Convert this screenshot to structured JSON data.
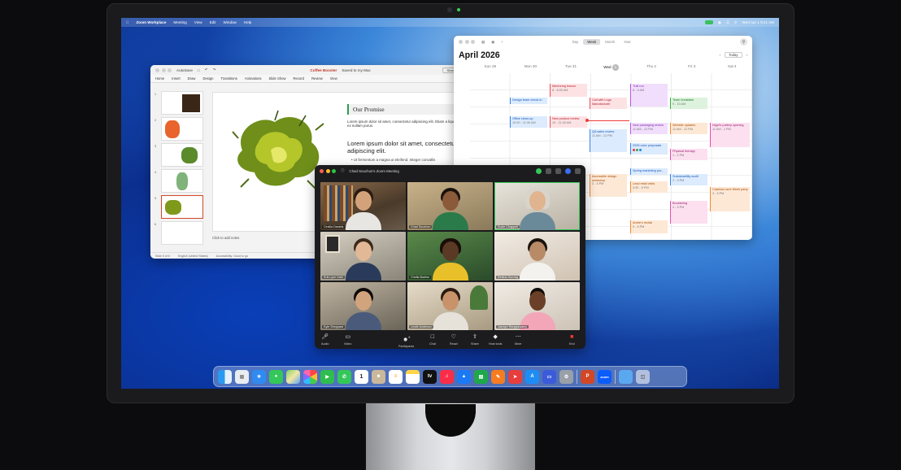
{
  "menubar": {
    "app": "Zoom Workplace",
    "items": [
      "Meeting",
      "View",
      "Edit",
      "Window",
      "Help"
    ],
    "clock": "Wed Apr 1 9:41 AM"
  },
  "powerpoint": {
    "autosave": "AutoSave",
    "doc_title": "Coffee Booster",
    "saved": "Saved to my Mac",
    "share": "Share",
    "ribbon_tabs": [
      "Home",
      "Insert",
      "Draw",
      "Design",
      "Transitions",
      "Animations",
      "Slide Show",
      "Record",
      "Review",
      "View"
    ],
    "thumb_numbers": [
      "1",
      "2",
      "3",
      "4",
      "5",
      "6"
    ],
    "slide": {
      "heading": "Our Promise",
      "body_small": "Lorem ipsum dolor sit amet, consectetur adipiscing elit. Etiam a liquet ex nullam purus.",
      "body_big": "Lorem ipsum dolor sit amet, consectetur adipiscing elit.",
      "bullet": "• Ut fermentum a magna ut eleifend. Integer convallis"
    },
    "notes": "Click to add notes",
    "status": [
      "Slide 5 of 6",
      "English (United States)",
      "Accessibility: Good to go"
    ]
  },
  "calendar": {
    "views": [
      "Day",
      "Week",
      "Month",
      "Year"
    ],
    "active_view": "Week",
    "month": "April 2026",
    "today": "Today",
    "days": [
      {
        "label": "Sun 29"
      },
      {
        "label": "Mon 30"
      },
      {
        "label": "Tue 31"
      },
      {
        "label": "Wed",
        "badge": "1"
      },
      {
        "label": "Thu 2"
      },
      {
        "label": "Fri 3"
      },
      {
        "label": "Sat 4"
      }
    ],
    "events": [
      {
        "title": "Mentoring lesson",
        "time": "8 - 8:30 AM",
        "color": "red"
      },
      {
        "title": "Design team check-in",
        "time": "",
        "color": "blue"
      },
      {
        "title": "Call with Logo Manufacturer",
        "time": "",
        "color": "red"
      },
      {
        "title": "Trail run",
        "time": "8 - 9 AM",
        "color": "purple"
      },
      {
        "title": "Team breakfast",
        "time": "9 - 10 AM",
        "color": "green"
      },
      {
        "title": "Office clean-up",
        "time": "10:30 - 11:30 AM",
        "color": "blue"
      },
      {
        "title": "New product review",
        "time": "10 - 11:30 AM",
        "color": "red"
      },
      {
        "title": "New packaging review",
        "time": "11 AM - 12 PM",
        "color": "purple"
      },
      {
        "title": "Website updates",
        "time": "11 AM - 12 PM",
        "color": "orange"
      },
      {
        "title": "Nigel's pottery opening",
        "time": "11 AM - 1 PM",
        "color": "pink"
      },
      {
        "title": "QA sales review",
        "time": "11 AM - 12 PM",
        "color": "blue"
      },
      {
        "title": "2025 color proposals",
        "time": "",
        "color": "blue"
      },
      {
        "title": "Physical therapy",
        "time": "1 - 2 PM",
        "color": "pink"
      },
      {
        "title": "Spring marketing pro...",
        "time": "",
        "color": "blue"
      },
      {
        "title": "Sustainability audit",
        "time": "2 - 3 PM",
        "color": "blue"
      },
      {
        "title": "Accessible design workshop",
        "time": "2 - 4 PM",
        "color": "orange"
      },
      {
        "title": "Lead retail visits",
        "time": "3:30 - 5 PM",
        "color": "orange"
      },
      {
        "title": "Catalina Lane Week party",
        "time": "3 - 5 PM",
        "color": "orange"
      },
      {
        "title": "Bouldering",
        "time": "4 - 5 PM",
        "color": "pink"
      },
      {
        "title": "Andre's recital",
        "time": "5 - 6 PM",
        "color": "orange"
      }
    ]
  },
  "zoom": {
    "title": "Chad Souchon's Zoom Meeting",
    "participants": [
      {
        "name": "Cecilia Daniels"
      },
      {
        "name": "Chad Souchon"
      },
      {
        "name": "Suzie Chappell"
      },
      {
        "name": "Kris Lyon Dahl"
      },
      {
        "name": "Chella Boehm"
      },
      {
        "name": "Reisha Gurung"
      },
      {
        "name": "Kyle Sheppard"
      },
      {
        "name": "Leslie Anderson"
      },
      {
        "name": "Jasmyn Rangaswamy"
      }
    ],
    "controls": {
      "audio": "Audio",
      "video": "Video",
      "participants": "Participants",
      "participants_count": "9",
      "chat": "Chat",
      "react": "React",
      "share": "Share",
      "host_tools": "Host tools",
      "more": "More",
      "end": "End"
    }
  },
  "dock": {
    "apps": [
      "finder-icon",
      "launchpad-icon",
      "safari-icon",
      "messages-icon",
      "maps-icon",
      "photos-icon",
      "facetime-icon",
      "phone-icon",
      "calendar-icon",
      "contacts-icon",
      "reminders-icon",
      "notes-icon",
      "tv-icon",
      "music-icon",
      "keynote-icon",
      "numbers-icon",
      "pages-icon",
      "app-store-icon",
      "system-settings-icon",
      "powerpoint-icon",
      "zoom-icon",
      "folder-icon",
      "trash-icon"
    ],
    "calendar_date": "1",
    "zoom_label": "zoom"
  }
}
